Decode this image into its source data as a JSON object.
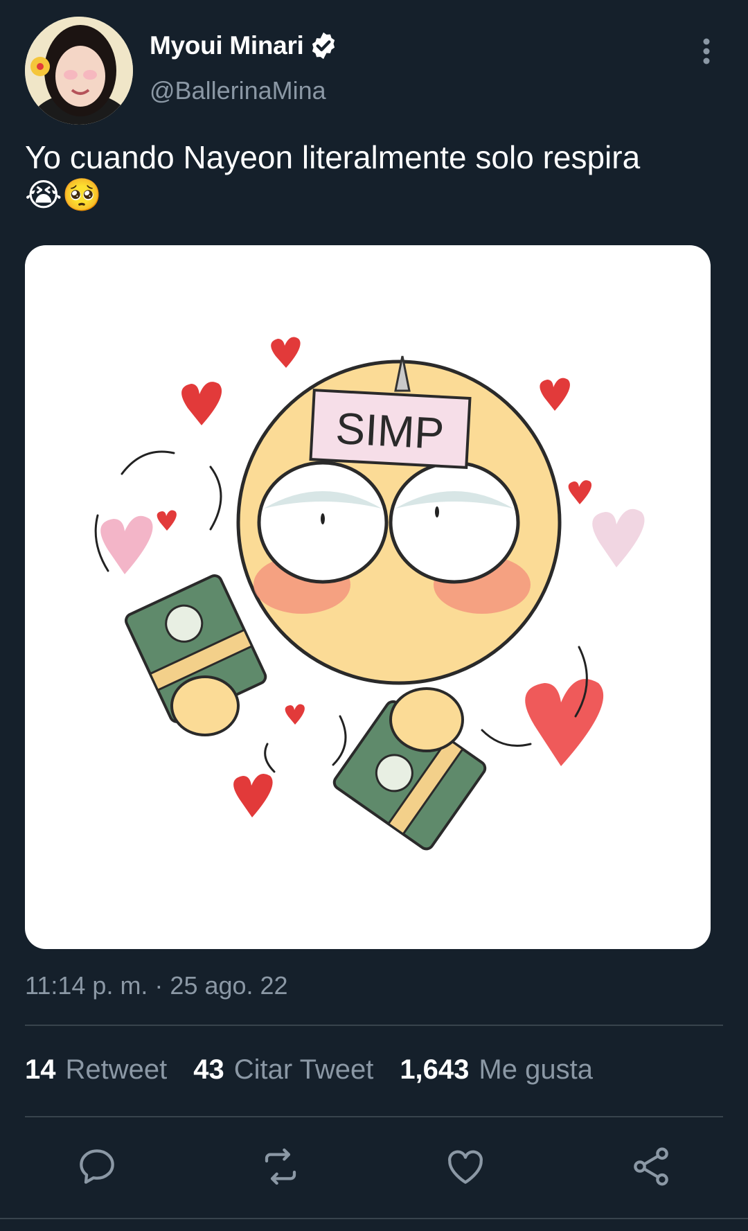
{
  "tweet": {
    "author": {
      "display_name": "Myoui Minari",
      "handle": "@BallerinaMina",
      "verified": true
    },
    "text": "Yo cuando Nayeon literalmente solo respira",
    "emojis": "😭🥺",
    "media": {
      "sign_text": "SIMP"
    },
    "timestamp": "11:14 p. m. · 25 ago. 22"
  },
  "stats": [
    {
      "count": "14",
      "label": "Retweet"
    },
    {
      "count": "43",
      "label": "Citar Tweet"
    },
    {
      "count": "1,643",
      "label": "Me gusta"
    }
  ],
  "actions": [
    "reply-icon",
    "retweet-icon",
    "like-icon",
    "share-icon"
  ],
  "colors": {
    "background": "#15202b",
    "secondary_text": "#8b98a5",
    "divider": "#38444d"
  }
}
